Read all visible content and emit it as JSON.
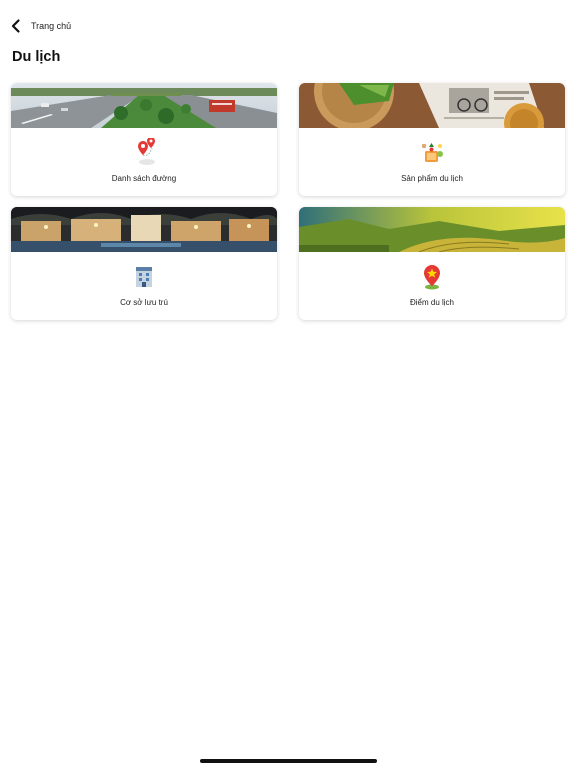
{
  "nav": {
    "back_label": "Trang chủ",
    "back_icon": "chevron-left-icon"
  },
  "page": {
    "title": "Du lịch"
  },
  "cards": [
    {
      "label": "Danh sách đường",
      "icon": "map-pins-icon",
      "banner": "highway-photo"
    },
    {
      "label": "Sản phẩm du lịch",
      "icon": "souvenir-products-icon",
      "banner": "local-products-photo"
    },
    {
      "label": "Cơ sở lưu trú",
      "icon": "hotel-icon",
      "banner": "resort-night-photo"
    },
    {
      "label": "Điểm du lịch",
      "icon": "location-star-pin-icon",
      "banner": "rice-terrace-photo"
    }
  ],
  "colors": {
    "accent_red": "#e53935",
    "text": "#222222",
    "background": "#ffffff"
  }
}
